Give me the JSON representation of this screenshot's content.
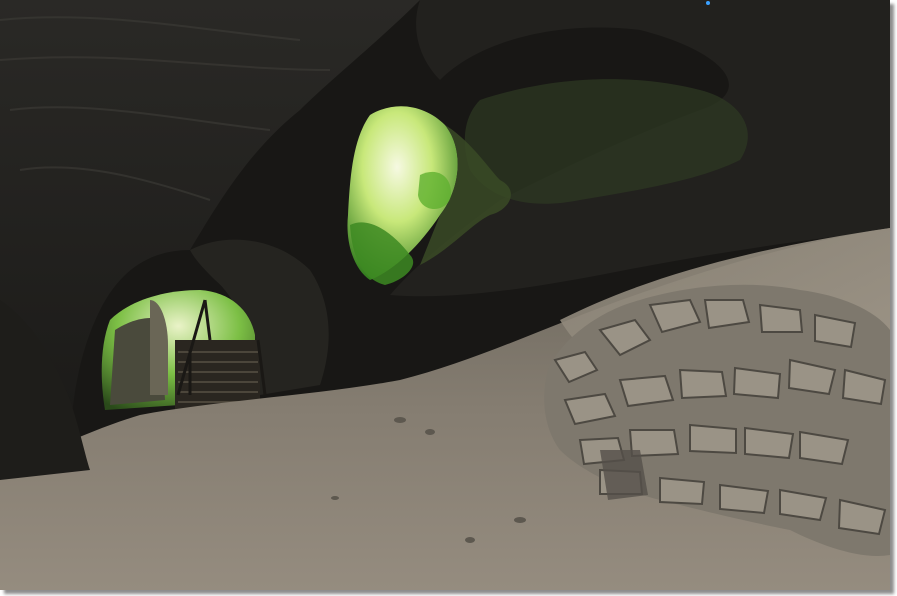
{
  "photo": {
    "subject": "cave-interior",
    "colors": {
      "rock_dark": "#1c1b19",
      "rock_mid": "#3a3833",
      "sand": "#7d766b",
      "sand_light": "#a59d90",
      "foliage": "#4fa32a",
      "foliage_bright": "#c8e87a",
      "sky": "#f2f6d8",
      "stone": "#8f897e"
    }
  }
}
